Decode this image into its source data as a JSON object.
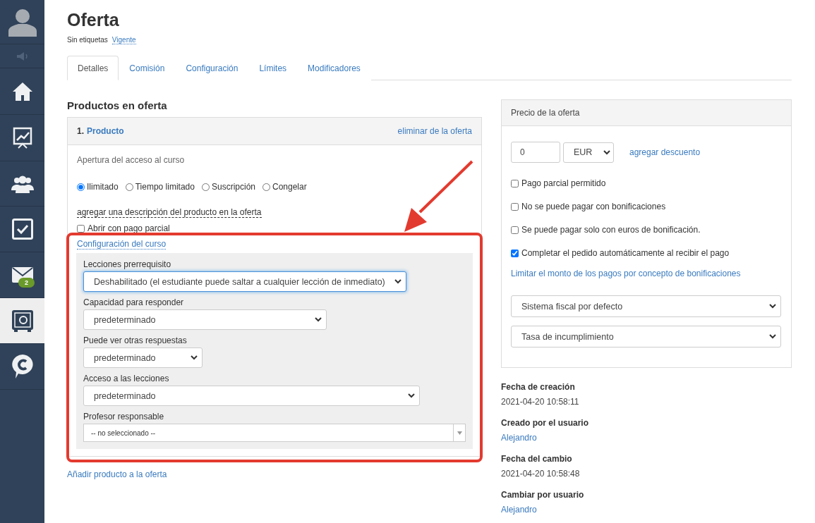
{
  "sidebar": {
    "items": [
      {
        "kind": "avatar",
        "selected": false
      },
      {
        "kind": "sound",
        "selected": false
      },
      {
        "kind": "home",
        "selected": false
      },
      {
        "kind": "chart",
        "selected": false
      },
      {
        "kind": "users",
        "selected": false
      },
      {
        "kind": "tasks",
        "selected": false
      },
      {
        "kind": "mail",
        "selected": false,
        "badge": "2"
      },
      {
        "kind": "safe",
        "selected": true
      },
      {
        "kind": "chat",
        "selected": false
      }
    ]
  },
  "title": "Oferta",
  "tags": {
    "label": "Sin etiquetas",
    "status": "Vigente"
  },
  "tabs": [
    {
      "label": "Detalles",
      "selected": true
    },
    {
      "label": "Comisión",
      "selected": false
    },
    {
      "label": "Configuración",
      "selected": false
    },
    {
      "label": "Límites",
      "selected": false
    },
    {
      "label": "Modificadores",
      "selected": false
    }
  ],
  "products": {
    "heading": "Productos en oferta",
    "product": {
      "number": "1.",
      "name": "Producto",
      "remove": "eliminar de la oferta",
      "access_label": "Apertura del acceso al curso",
      "access_options": [
        {
          "label": "Ilimitado",
          "selected": true
        },
        {
          "label": "Tiempo limitado",
          "selected": false
        },
        {
          "label": "Suscripción",
          "selected": false
        },
        {
          "label": "Congelar",
          "selected": false
        }
      ],
      "description_link": "agregar una descripción del producto en la oferta",
      "partial_open": {
        "label": "Abrir con pago parcial",
        "checked": false
      },
      "course_settings": {
        "link": "Configuración del curso",
        "fields": [
          {
            "label": "Lecciones prerrequisito",
            "value": "Deshabilitado (el estudiante puede saltar a cualquier lección de inmediato)",
            "focused": true
          },
          {
            "label": "Capacidad para responder",
            "value": "predeterminado",
            "focused": false
          },
          {
            "label": "Puede ver otras respuestas",
            "value": "predeterminado",
            "focused": false
          },
          {
            "label": "Acceso a las lecciones",
            "value": "predeterminado",
            "focused": false
          },
          {
            "label": "Profesor responsable",
            "value": "-- no seleccionado --",
            "kind": "combo"
          }
        ]
      }
    },
    "add_link": "Añadir producto a la oferta"
  },
  "price": {
    "heading": "Precio de la oferta",
    "amount": "0",
    "currency": "EUR",
    "discount_link": "agregar descuento",
    "options": [
      {
        "label": "Pago parcial permitido",
        "checked": false
      },
      {
        "label": "No se puede pagar con bonificaciones",
        "checked": false
      },
      {
        "label": "Se puede pagar solo con euros de bonificación.",
        "checked": false
      },
      {
        "label": "Completar el pedido automáticamente al recibir el pago",
        "checked": true
      }
    ],
    "limit_link": "Limitar el monto de los pagos por concepto de bonificaciones",
    "selects": [
      "Sistema fiscal por defecto",
      "Tasa de incumplimiento"
    ]
  },
  "meta": [
    {
      "label": "Fecha de creación",
      "value": "2021-04-20 10:58:11",
      "kind": "text"
    },
    {
      "label": "Creado por el usuario",
      "value": "Alejandro",
      "kind": "link"
    },
    {
      "label": "Fecha del cambio",
      "value": "2021-04-20 10:58:48",
      "kind": "text"
    },
    {
      "label": "Cambiar por usuario",
      "value": "Alejandro",
      "kind": "link"
    }
  ]
}
